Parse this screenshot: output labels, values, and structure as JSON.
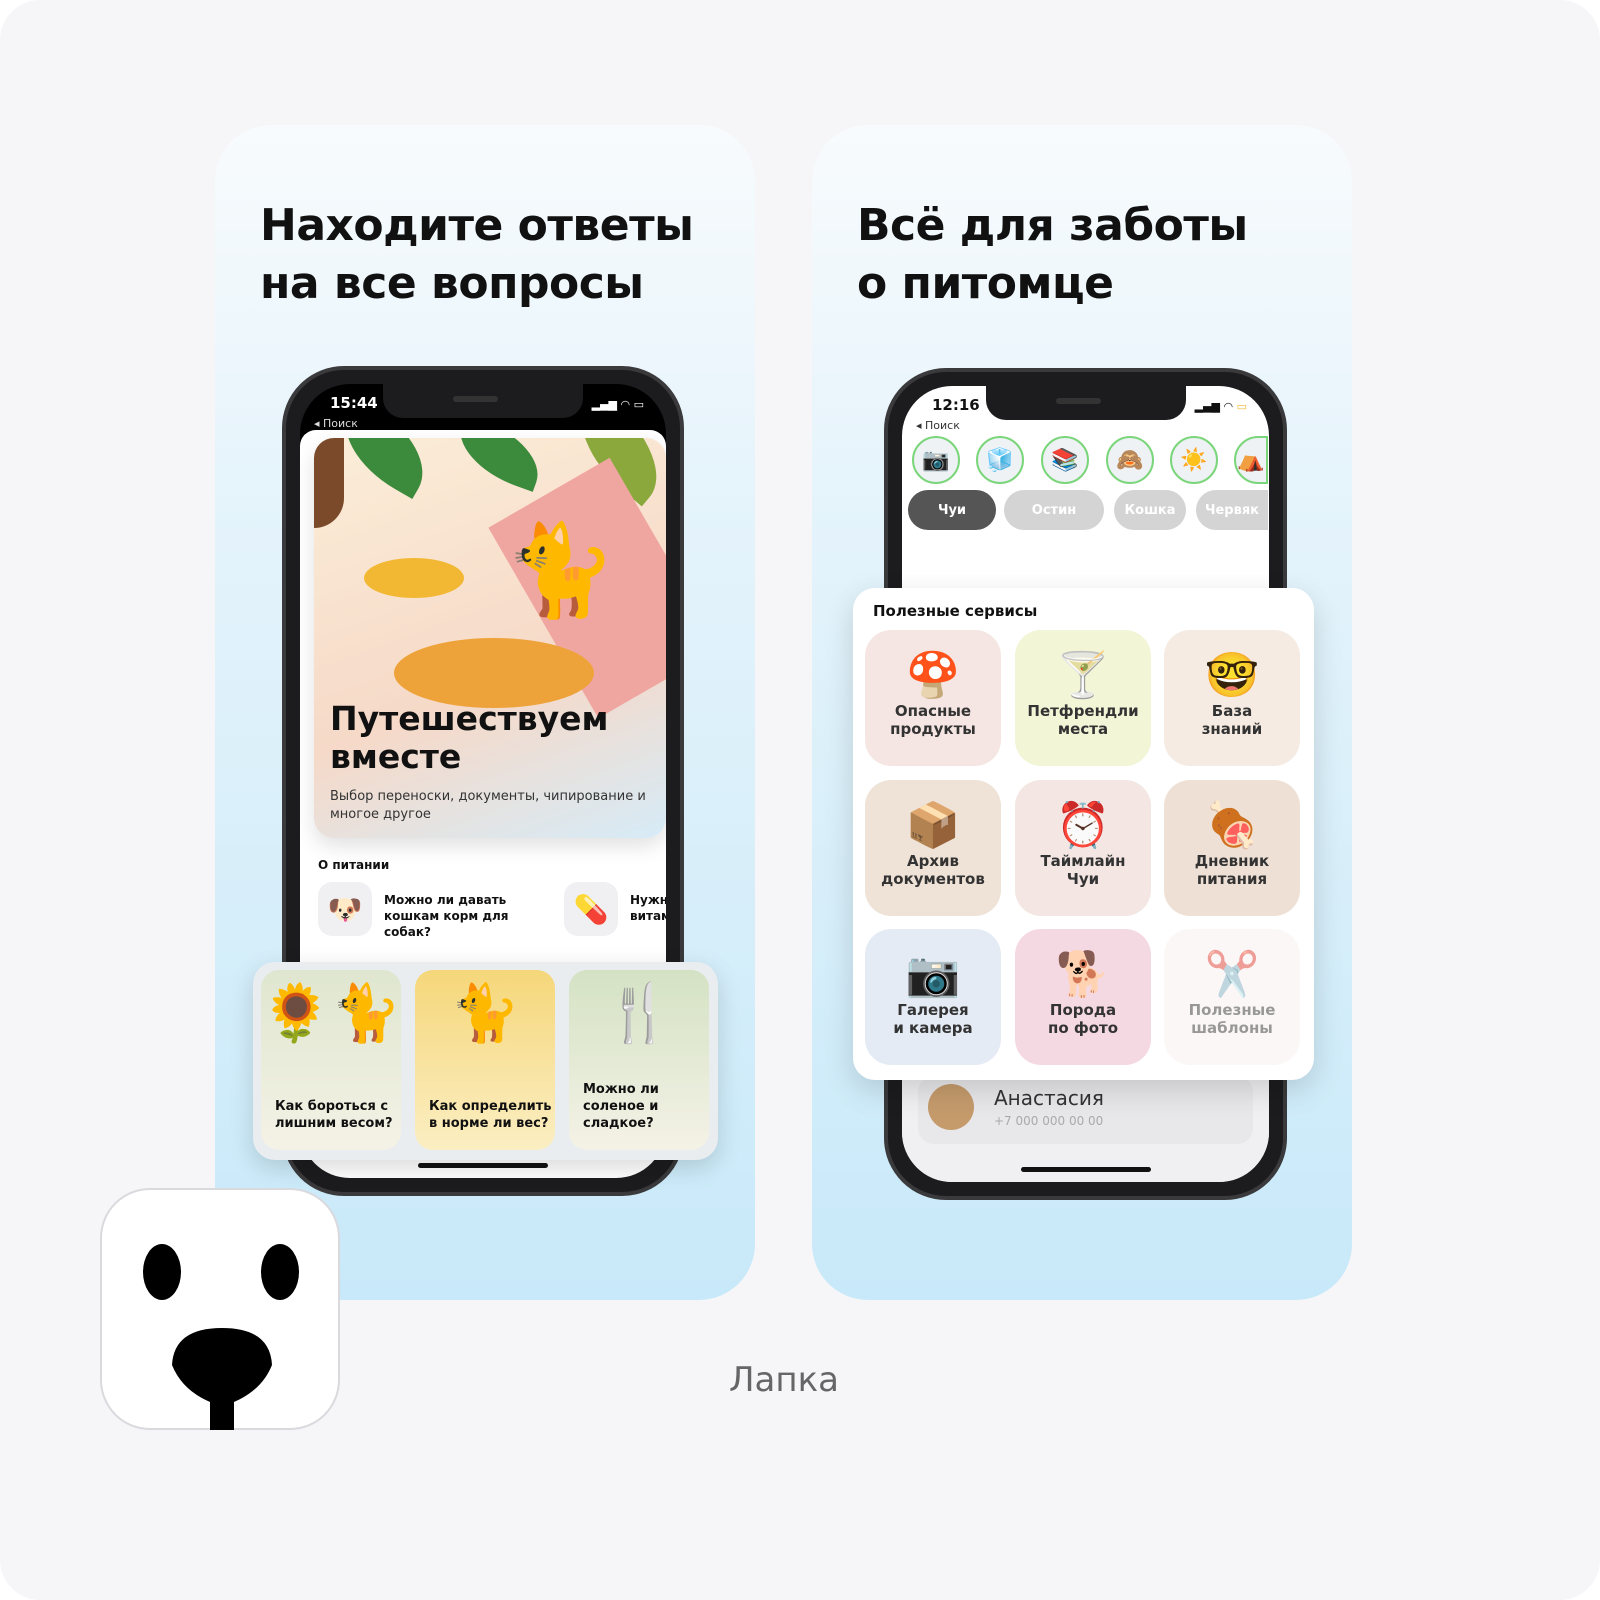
{
  "left_card": {
    "headline_line1": "Находите ответы",
    "headline_line2": "на все вопросы",
    "status": {
      "time": "15:44",
      "back": "◂ Поиск"
    },
    "hero": {
      "title_line1": "Путешествуем",
      "title_line2": "вместе",
      "subtitle": "Выбор переноски, документы, чипирование и многое другое"
    },
    "section": "О питании",
    "questions": [
      {
        "icon": "dog-face-icon",
        "emoji": "🐶",
        "text": "Можно ли давать кошкам корм для собак?"
      },
      {
        "icon": "pill-icon",
        "emoji": "💊",
        "text": "Нужны витам"
      }
    ],
    "tiles": [
      {
        "label": "Как бороться с лишним весом?",
        "emoji": "🐈",
        "color": "#dfe6cf"
      },
      {
        "label": "Как определить в норме ли вес?",
        "emoji": "🐈",
        "color": "#f5d77a"
      },
      {
        "label": "Можно ли соленое и сладкое?",
        "emoji": "🍴",
        "color": "#d4e2c4"
      }
    ]
  },
  "right_card": {
    "headline_line1": "Всё для заботы",
    "headline_line2": "о питомце",
    "status": {
      "time": "12:16",
      "back": "◂ Поиск"
    },
    "stories": [
      "📷",
      "🧊",
      "📚",
      "🙈",
      "☀️",
      "⛺"
    ],
    "pets": [
      "Чуи",
      "Остин",
      "Кошка",
      "Червяк"
    ],
    "services_title": "Полезные сервисы",
    "services": [
      {
        "label1": "Опасные",
        "label2": "продукты",
        "emoji": "🍄",
        "icon": "mushroom-icon",
        "bg": "#f5e6e3"
      },
      {
        "label1": "Петфрендли",
        "label2": "места",
        "emoji": "🍸",
        "icon": "cocktail-icon",
        "bg": "#f2f5d6"
      },
      {
        "label1": "База",
        "label2": "знаний",
        "emoji": "🤓",
        "icon": "nerd-face-icon",
        "bg": "#f6ebe2"
      },
      {
        "label1": "Архив",
        "label2": "документов",
        "emoji": "📦",
        "icon": "package-icon",
        "bg": "#efe2d6"
      },
      {
        "label1": "Таймлайн",
        "label2": "Чуи",
        "emoji": "⏰",
        "icon": "alarm-clock-icon",
        "bg": "#f3e6e3"
      },
      {
        "label1": "Дневник",
        "label2": "питания",
        "emoji": "🍖",
        "icon": "meat-icon",
        "bg": "#efe0d6"
      },
      {
        "label1": "Галерея",
        "label2": "и камера",
        "emoji": "📷",
        "icon": "camera-icon",
        "bg": "#e4ebf4"
      },
      {
        "label1": "Порода",
        "label2": "по фото",
        "emoji": "🐕",
        "icon": "dog-icon",
        "bg": "#f5d9e2"
      },
      {
        "label1": "Полезные",
        "label2": "шаблоны",
        "emoji": "✂️",
        "icon": "scissors-icon",
        "bg": "#fbf1f1"
      }
    ],
    "profile": {
      "name": "Анастасия",
      "phone": "+7 000 000 00 00"
    }
  },
  "app": {
    "name": "Лапка"
  }
}
